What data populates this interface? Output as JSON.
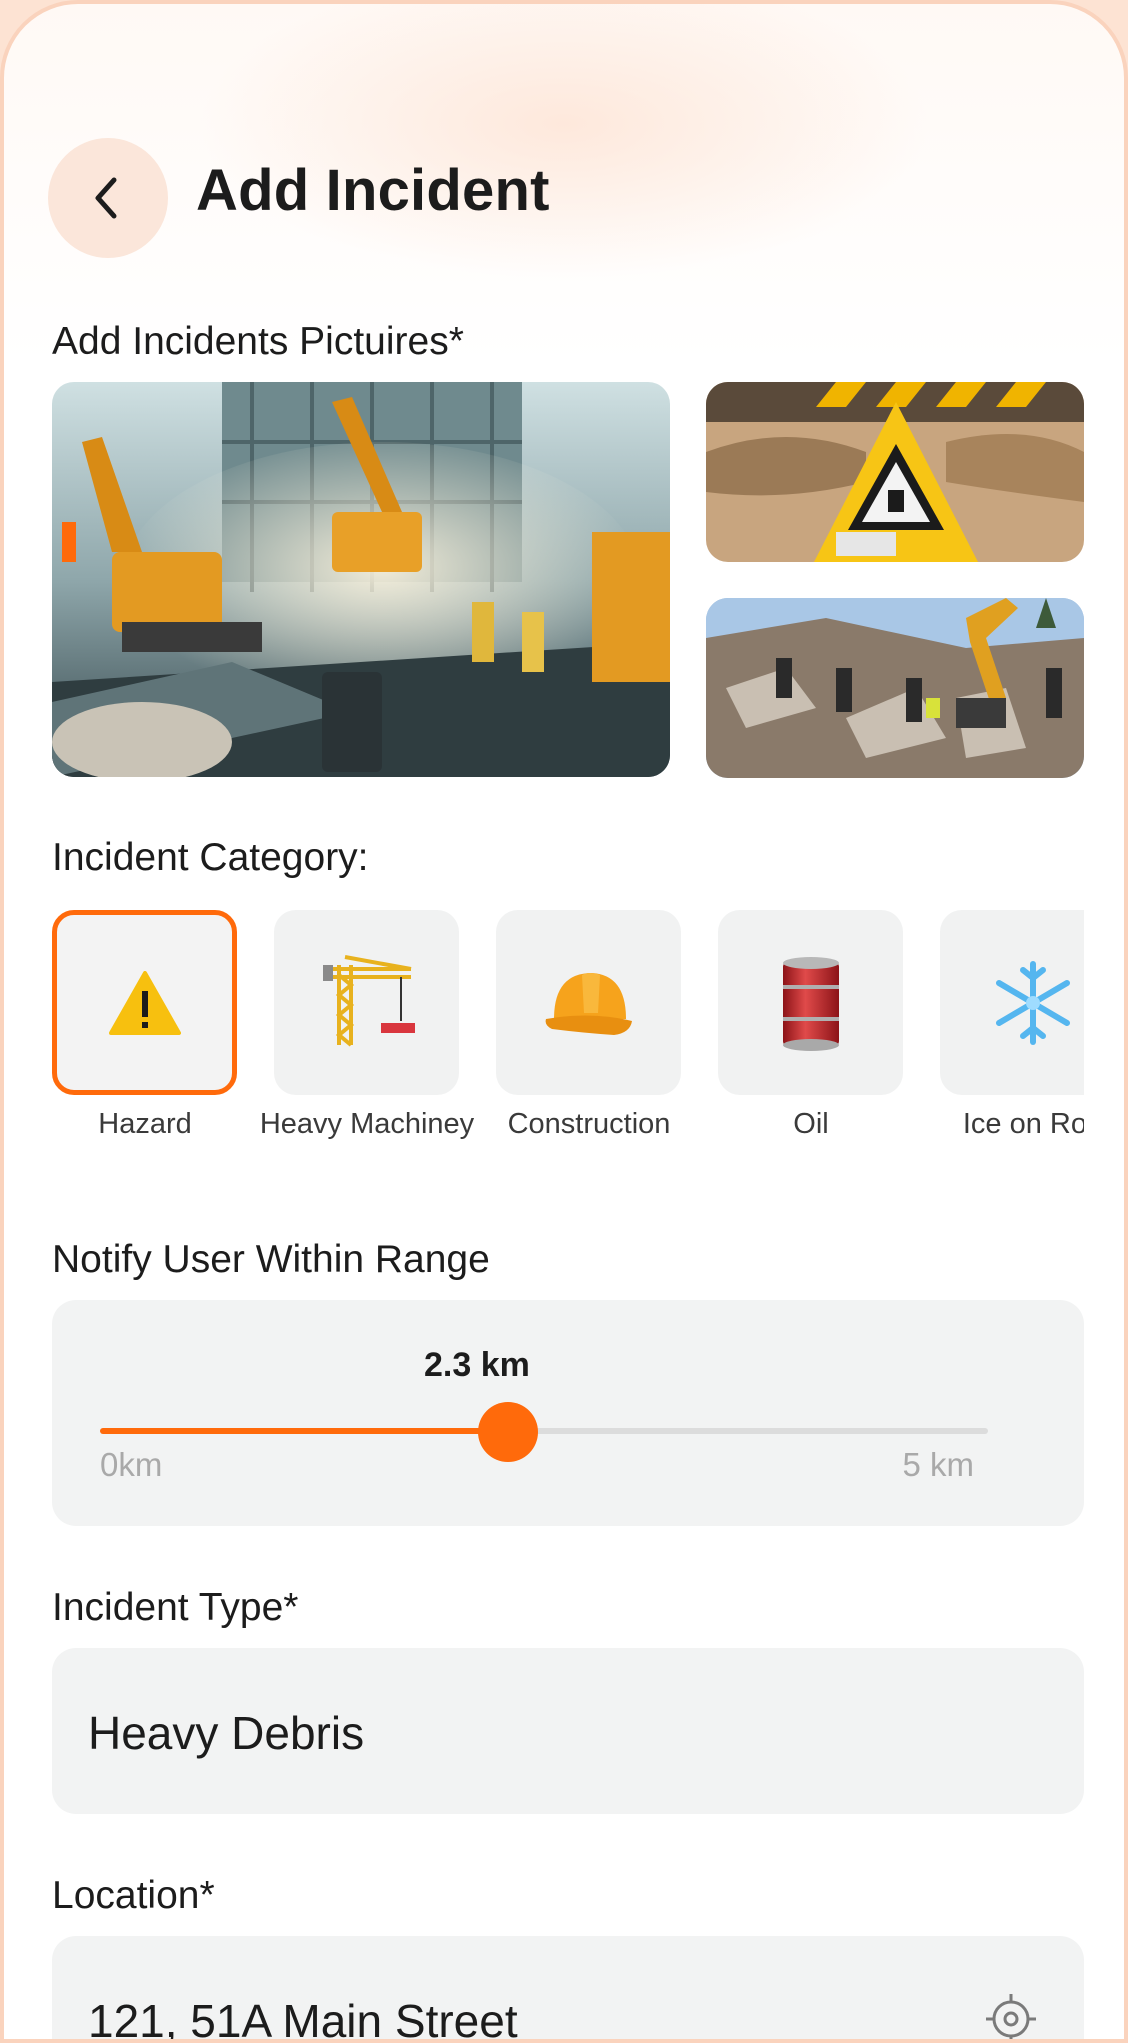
{
  "header": {
    "title": "Add Incident",
    "back_icon": "chevron-left-icon"
  },
  "pictures": {
    "label": "Add Incidents Pictuires*",
    "items": [
      {
        "name": "construction-site-excavators",
        "alt": "construction site with excavators"
      },
      {
        "name": "warning-sign",
        "alt": "warning sign"
      },
      {
        "name": "collapsed-building-rescue",
        "alt": "rescue at collapsed building"
      }
    ]
  },
  "category": {
    "label": "Incident Category:",
    "selected": "Hazard",
    "items": [
      {
        "label": "Hazard",
        "icon": "warning-icon"
      },
      {
        "label": "Heavy Machiney",
        "icon": "crane-icon"
      },
      {
        "label": "Construction",
        "icon": "hard-hat-icon"
      },
      {
        "label": "Oil",
        "icon": "oil-barrel-icon"
      },
      {
        "label": "Ice on Roa",
        "icon": "snowflake-icon"
      }
    ]
  },
  "range": {
    "label": "Notify User Within Range",
    "value_text": "2.3 km",
    "value": 2.3,
    "min_label": "0km",
    "max_label": "5 km",
    "min": 0,
    "max": 5
  },
  "incident_type": {
    "label": "Incident Type*",
    "value": "Heavy Debris"
  },
  "location": {
    "label": "Location*",
    "value": "121, 51A Main Street",
    "icon": "locate-icon"
  },
  "colors": {
    "accent": "#ff6a0b",
    "panel": "#f2f3f3"
  }
}
